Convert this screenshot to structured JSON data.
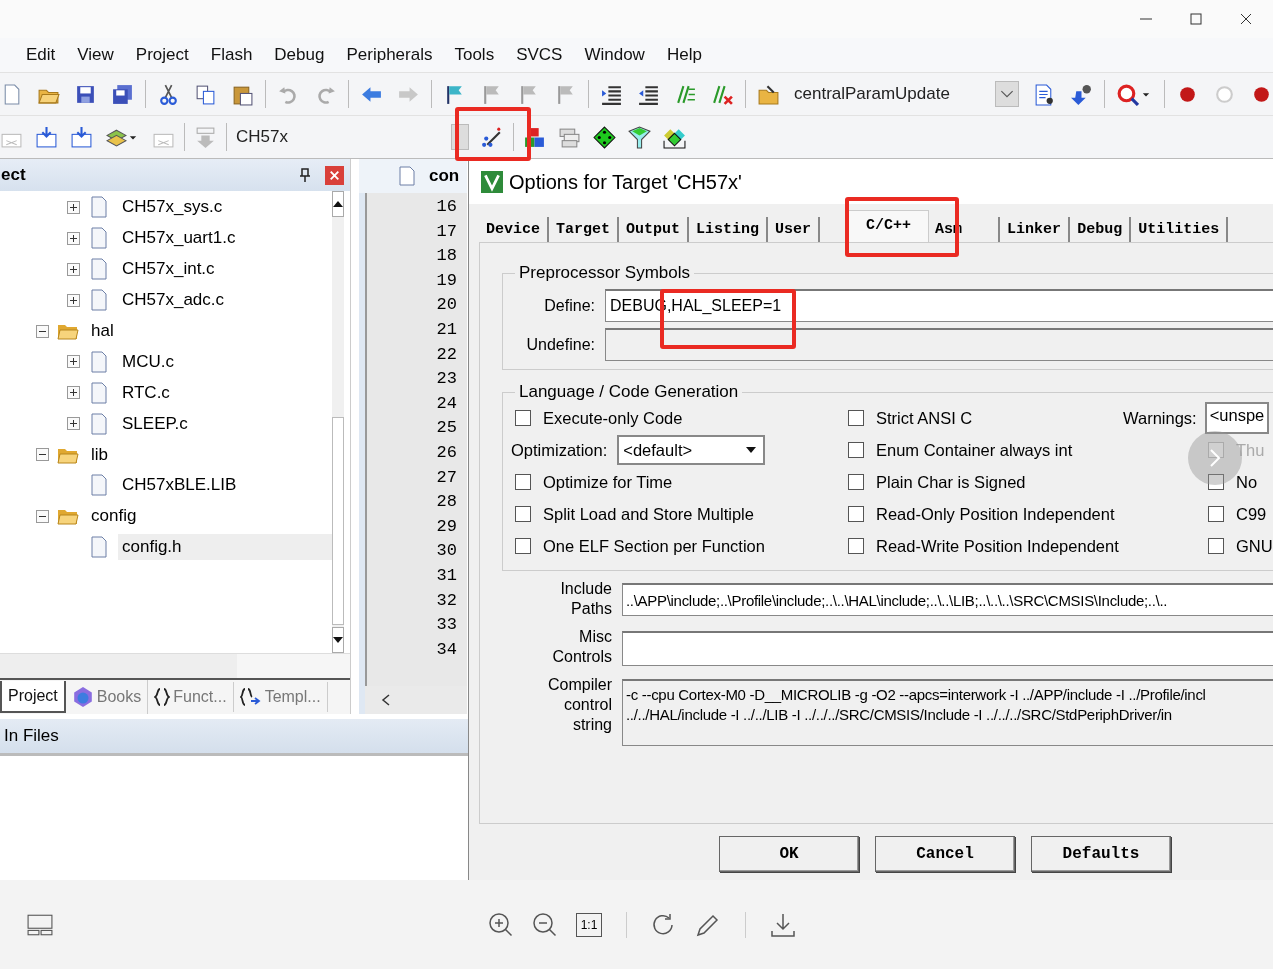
{
  "viewer": {
    "actual_size_label": "1:1"
  },
  "ide": {
    "menu": [
      "Edit",
      "View",
      "Project",
      "Flash",
      "Debug",
      "Peripherals",
      "Tools",
      "SVCS",
      "Window",
      "Help"
    ],
    "toolbar_target": "centralParamUpdate",
    "build_target": "CH57x",
    "project_panel": {
      "title": "ect",
      "tree": [
        {
          "label": "CH57x_sys.c",
          "kind": "file",
          "expanded": false,
          "selected": false
        },
        {
          "label": "CH57x_uart1.c",
          "kind": "file",
          "expanded": false,
          "selected": false
        },
        {
          "label": "CH57x_int.c",
          "kind": "file",
          "expanded": false,
          "selected": false
        },
        {
          "label": "CH57x_adc.c",
          "kind": "file",
          "expanded": false,
          "selected": false
        },
        {
          "label": "hal",
          "kind": "folder",
          "expanded": true,
          "selected": false,
          "children": [
            {
              "label": "MCU.c",
              "kind": "file",
              "expanded": false,
              "selected": false
            },
            {
              "label": "RTC.c",
              "kind": "file",
              "expanded": false,
              "selected": false
            },
            {
              "label": "SLEEP.c",
              "kind": "file",
              "expanded": false,
              "selected": false
            }
          ]
        },
        {
          "label": "lib",
          "kind": "folder",
          "expanded": true,
          "selected": false,
          "children": [
            {
              "label": "CH57xBLE.LIB",
              "kind": "file",
              "selected": false
            }
          ]
        },
        {
          "label": "config",
          "kind": "folder",
          "expanded": true,
          "selected": false,
          "children": [
            {
              "label": "config.h",
              "kind": "file",
              "selected": true
            }
          ]
        }
      ],
      "tabs": [
        {
          "label": "Project",
          "selected": true
        },
        {
          "label": "Books",
          "selected": false
        },
        {
          "label": "Funct...",
          "selected": false
        },
        {
          "label": "Templ...",
          "selected": false
        }
      ]
    },
    "editor": {
      "tab": "con",
      "line_numbers": [
        "16",
        "17",
        "18",
        "19",
        "20",
        "21",
        "22",
        "23",
        "24",
        "25",
        "26",
        "27",
        "28",
        "29",
        "30",
        "31",
        "32",
        "33",
        "34"
      ]
    },
    "find_panel": {
      "title": "In Files"
    }
  },
  "dialog": {
    "title": "Options for Target 'CH57x'",
    "tabs": [
      {
        "label": "Device",
        "selected": false
      },
      {
        "label": "Target",
        "selected": false
      },
      {
        "label": "Output",
        "selected": false
      },
      {
        "label": "Listing",
        "selected": false
      },
      {
        "label": "User",
        "selected": false
      },
      {
        "label": "C/C++",
        "selected": true
      },
      {
        "label": "Asm",
        "selected": false
      },
      {
        "label": "Linker",
        "selected": false
      },
      {
        "label": "Debug",
        "selected": false
      },
      {
        "label": "Utilities",
        "selected": false
      }
    ],
    "preprocessor": {
      "title": "Preprocessor Symbols",
      "define_label": "Define:",
      "define": "DEBUG,HAL_SLEEP=1",
      "undefine_label": "Undefine:"
    },
    "language": {
      "title": "Language / Code Generation",
      "column_1": [
        {
          "label": "Execute-only Code",
          "checked": false
        },
        {
          "kind": "select",
          "label": "Optimization:",
          "value": "<default>"
        },
        {
          "label": "Optimize for Time",
          "checked": false
        },
        {
          "label": "Split Load and Store Multiple",
          "checked": false
        },
        {
          "label": "One ELF Section per Function",
          "checked": false
        }
      ],
      "column_2": [
        {
          "label": "Strict ANSI C",
          "checked": false
        },
        {
          "label": "Enum Container always int",
          "checked": false
        },
        {
          "label": "Plain Char is Signed",
          "checked": false
        },
        {
          "label": "Read-Only Position Independent",
          "checked": false
        },
        {
          "label": "Read-Write Position Independent",
          "checked": false
        }
      ],
      "warnings_label": "Warnings:",
      "warnings": "<unspe",
      "column_3": [
        {
          "label": "Thu",
          "checked": false,
          "disabled": true
        },
        {
          "label": "No",
          "checked": false,
          "disabled": false
        },
        {
          "label": "C99",
          "checked": false,
          "disabled": false
        },
        {
          "label": "GNU",
          "checked": false,
          "disabled": false
        }
      ]
    },
    "include_label": "Include Paths",
    "include_paths": "..\\APP\\include;..\\Profile\\include;..\\..\\HAL\\include;..\\..\\LIB;..\\..\\..\\SRC\\CMSIS\\Include;..\\..",
    "misc_label": "Misc Controls",
    "compiler_label": "Compiler control string",
    "compiler_string": [
      "-c --cpu Cortex-M0 -D__MICROLIB -g -O2 --apcs=interwork -I ../APP/include -I ../Profile/incl",
      "../../HAL/include -I ../../LIB -I ../../../SRC/CMSIS/Include -I ../../../SRC/StdPeriphDriver/in"
    ],
    "buttons": [
      "OK",
      "Cancel",
      "Defaults"
    ]
  }
}
